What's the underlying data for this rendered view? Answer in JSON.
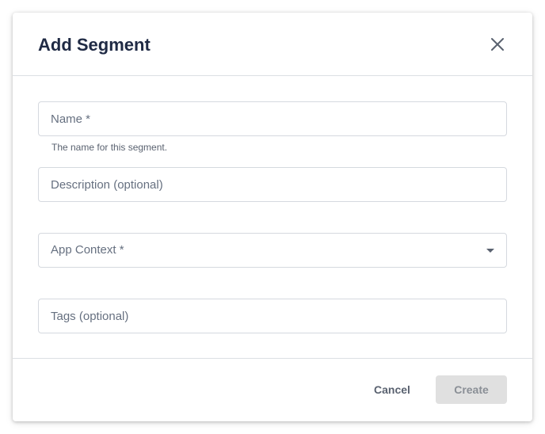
{
  "dialog": {
    "title": "Add Segment",
    "close_icon": "close-icon"
  },
  "form": {
    "name": {
      "placeholder": "Name *",
      "helper": "The name for this segment.",
      "value": ""
    },
    "description": {
      "placeholder": "Description (optional)",
      "value": ""
    },
    "app_context": {
      "placeholder": "App Context *",
      "icon": "chevron-down-icon"
    },
    "tags": {
      "placeholder": "Tags (optional)",
      "value": ""
    }
  },
  "footer": {
    "cancel_label": "Cancel",
    "create_label": "Create"
  },
  "colors": {
    "title": "#1f2a44",
    "border": "#d5d9df",
    "disabled_button_bg": "#e0e0e0",
    "disabled_button_text": "#8a8f96"
  }
}
